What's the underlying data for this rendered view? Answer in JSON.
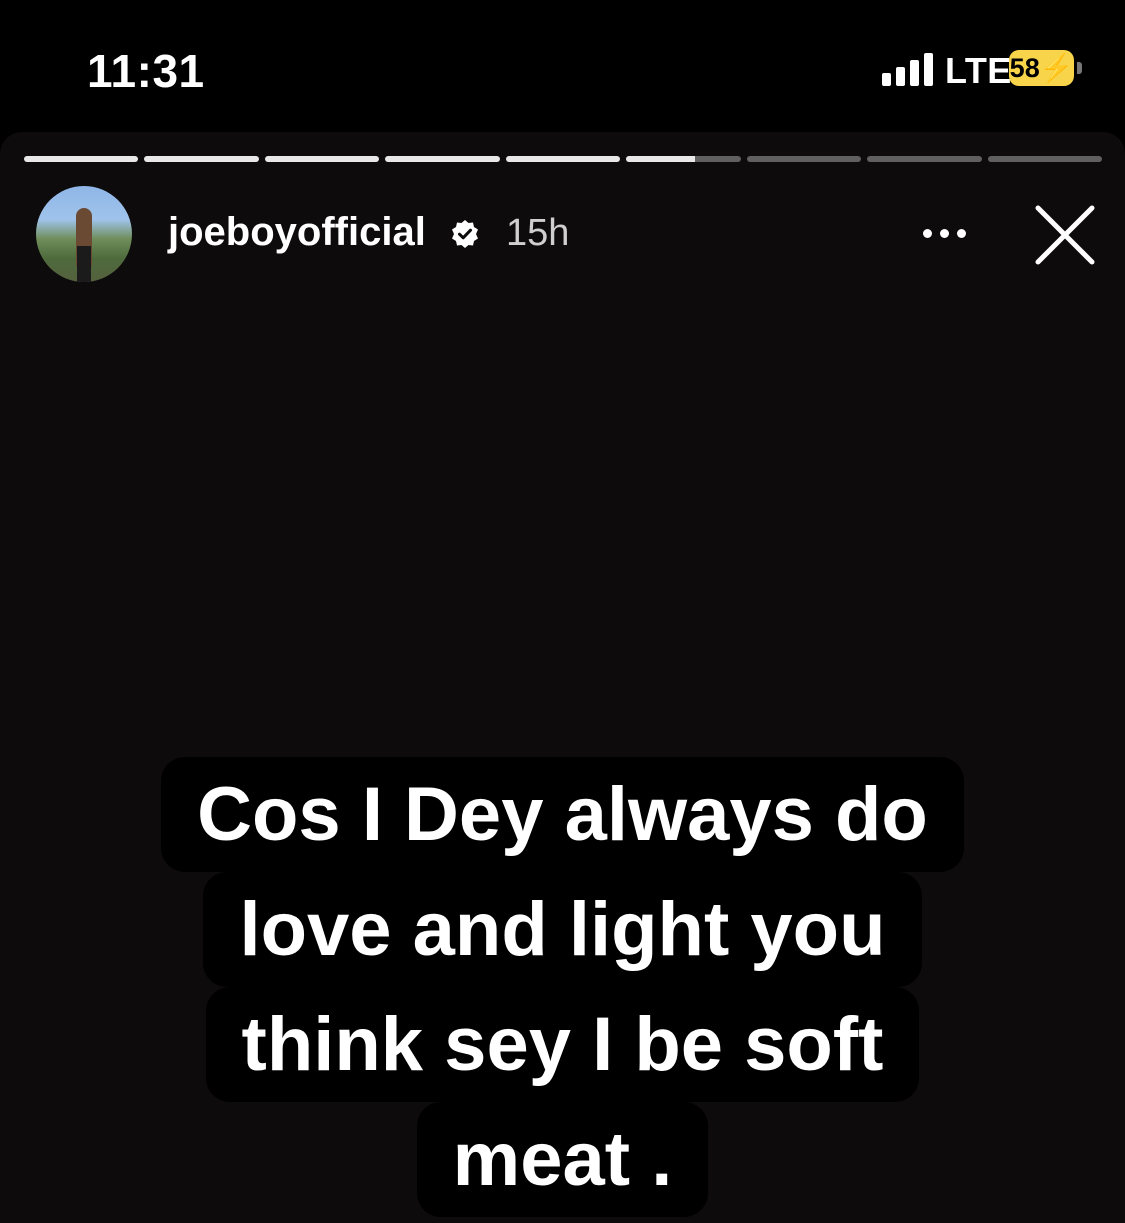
{
  "status_bar": {
    "time": "11:31",
    "network": "LTE",
    "battery": "58⚡",
    "battery_color": "#f7d44a"
  },
  "story": {
    "progress": [
      1,
      1,
      1,
      1,
      1,
      0.6,
      0,
      0,
      0
    ],
    "username": "joeboyofficial",
    "verified_icon": "verified-badge-icon",
    "time_ago": "15h",
    "more_icon": "more-horizontal-icon",
    "close_icon": "close-icon",
    "caption_lines": [
      "Cos I Dey always do",
      "love and light you",
      "think sey I be soft",
      "meat ."
    ]
  }
}
